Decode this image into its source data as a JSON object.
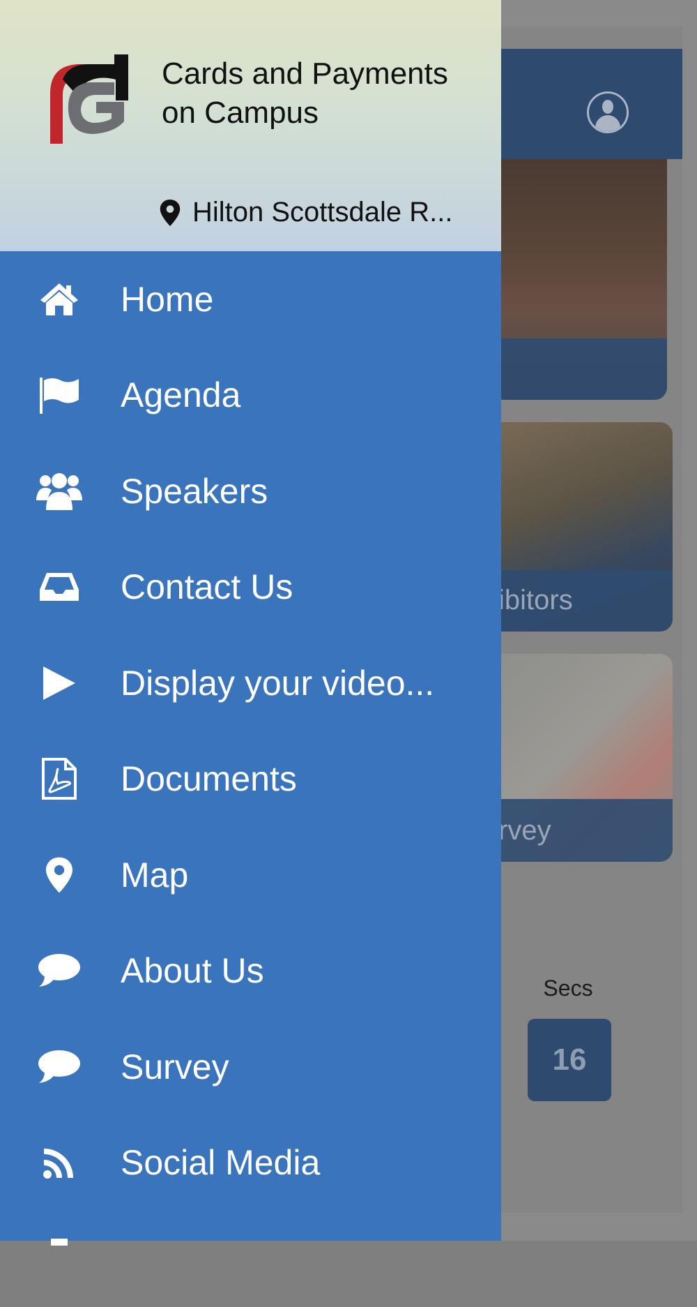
{
  "background": {
    "card_labels": [
      "ibitors",
      "rvey"
    ],
    "countdown": {
      "label": "Secs",
      "value": "16"
    }
  },
  "drawer": {
    "header": {
      "title": "Cards and Payments on Campus",
      "location": "Hilton Scottsdale R..."
    },
    "items": [
      {
        "label": "Home",
        "icon": "home-icon"
      },
      {
        "label": "Agenda",
        "icon": "flag-icon"
      },
      {
        "label": "Speakers",
        "icon": "users-icon"
      },
      {
        "label": "Contact Us",
        "icon": "inbox-icon"
      },
      {
        "label": "Display your video...",
        "icon": "play-icon"
      },
      {
        "label": "Documents",
        "icon": "pdf-icon"
      },
      {
        "label": "Map",
        "icon": "map-marker-icon"
      },
      {
        "label": "About Us",
        "icon": "comment-icon"
      },
      {
        "label": "Survey",
        "icon": "comment-icon"
      },
      {
        "label": "Social Media",
        "icon": "rss-icon"
      }
    ]
  },
  "colors": {
    "drawer_bg": "#3a74bc",
    "navbar_bg": "#2e4a6f",
    "logo_red": "#c0272d",
    "logo_gray": "#6d6e71"
  }
}
